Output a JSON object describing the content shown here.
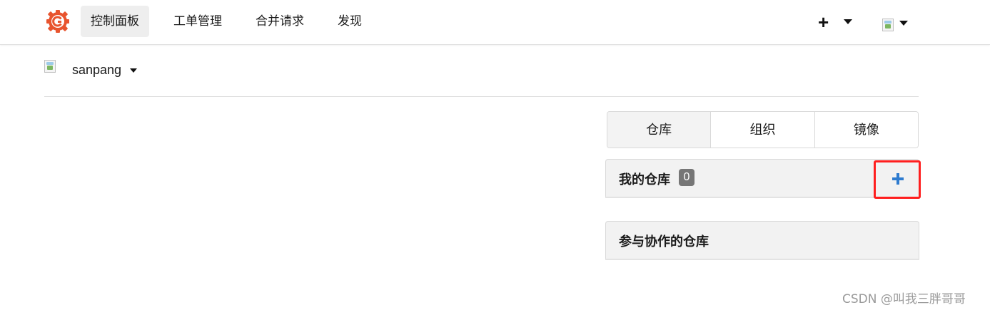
{
  "header": {
    "logo_icon": "gitea-logo-icon",
    "brand_color": "#e8542e",
    "nav": [
      {
        "label": "控制面板",
        "active": true
      },
      {
        "label": "工单管理",
        "active": false
      },
      {
        "label": "合并请求",
        "active": false
      },
      {
        "label": "发现",
        "active": false
      }
    ],
    "create_icon": "plus-icon",
    "user_menu_icon": "avatar-icon"
  },
  "context": {
    "name": "sanpang"
  },
  "tabs": [
    {
      "label": "仓库",
      "active": true
    },
    {
      "label": "组织",
      "active": false
    },
    {
      "label": "镜像",
      "active": false
    }
  ],
  "my_repos": {
    "title": "我的仓库",
    "count": "0",
    "add_icon": "plus-icon",
    "highlight_color": "#ff1f1f"
  },
  "collab_repos": {
    "title": "参与协作的仓库"
  },
  "watermark": "CSDN @叫我三胖哥哥"
}
